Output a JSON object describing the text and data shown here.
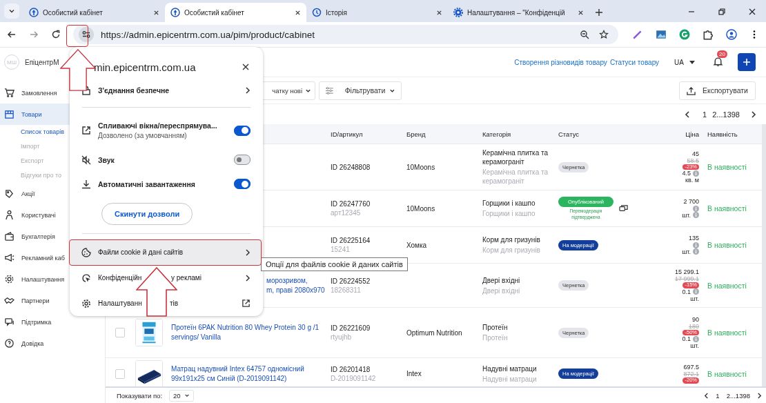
{
  "browser": {
    "tabs": [
      {
        "title": "Особистий кабінет",
        "kind": "site",
        "selected": false
      },
      {
        "title": "Особистий кабінет",
        "kind": "site",
        "selected": true
      },
      {
        "title": "Історія",
        "kind": "history",
        "selected": false
      },
      {
        "title": "Налаштування – \"Конфіденцій",
        "kind": "settings",
        "selected": false
      }
    ],
    "url": "https://admin.epicentrm.com.ua/pim/product/cabinet"
  },
  "app": {
    "avatar": "МШ",
    "brand": "ЕпіцентрМ",
    "header_links": [
      "Створення різновидів товару",
      "Статуси товару"
    ],
    "language": "UA",
    "notifications": "20"
  },
  "sidebar": {
    "items": [
      {
        "label": "Замовлення",
        "selected": false
      },
      {
        "label": "Товари",
        "selected": true,
        "children": [
          {
            "label": "Список товарів",
            "selected": true
          },
          {
            "label": "Імпорт",
            "selected": false
          },
          {
            "label": "Експорт",
            "selected": false
          },
          {
            "label": "Відгуки про то",
            "selected": false
          }
        ]
      },
      {
        "label": "Акції",
        "selected": false
      },
      {
        "label": "Користувачі",
        "selected": false
      },
      {
        "label": "Бухгалтерія",
        "selected": false
      },
      {
        "label": "Рекламний каб",
        "selected": false
      },
      {
        "label": "Налаштування",
        "selected": false
      },
      {
        "label": "Партнери",
        "selected": false
      },
      {
        "label": "Підтримка",
        "selected": false
      },
      {
        "label": "Довідка",
        "selected": false
      }
    ]
  },
  "toolbar": {
    "sort": "чатку нові",
    "filter": "Фільтрувати",
    "export": "Експортувати"
  },
  "pagination": {
    "current": "1",
    "rest": "2...1398"
  },
  "table": {
    "columns": [
      "ID/артикул",
      "Бренд",
      "Категорія",
      "Статус",
      "Ціна",
      "Наявність"
    ],
    "rows": [
      {
        "id": "ID 26248808",
        "brand": "10Moons",
        "category": "Керамічна плитка та керамограніт",
        "category_sub": "Керамічна плитка та керамограніт",
        "status": {
          "kind": "draft",
          "label": "Чернетка"
        },
        "price": "45",
        "old_price": "58.5",
        "discount": "-23%",
        "qty": "4.5",
        "unit": "кв. м",
        "availability": "В наявності"
      },
      {
        "id": "ID 26247760",
        "article": "арт12345",
        "brand": "10Moons",
        "category": "Горщики і кашпо",
        "category_sub": "Горщики і кашпо",
        "status": {
          "kind": "published",
          "label": "Опублікований",
          "note": "Перемодерація підтверджена"
        },
        "comments": true,
        "price": "2 700",
        "unit": "шт.",
        "availability": "В наявності"
      },
      {
        "id": "ID 26225164",
        "article": "15241",
        "brand": "Хомка",
        "category": "Корм для гризунів",
        "category_sub": "Корм для гризунів",
        "status": {
          "kind": "moderation",
          "label": "На модерації"
        },
        "price": "135",
        "unit": "шт.",
        "availability": "В наявності"
      },
      {
        "name_lines": [
          "морозривом,",
          "m, праві 2080x970"
        ],
        "id": "ID 26224552",
        "article": "18268311",
        "category": "Двері вхідні",
        "category_sub": "Двері вхідні",
        "status": {
          "kind": "draft",
          "label": "Чернетка"
        },
        "price": "15 299.1",
        "old_price": "17 999.1",
        "discount": "-15%",
        "qty": "0.1",
        "unit": "шт.",
        "availability": "В наявності"
      },
      {
        "checked": false,
        "name": "Протеїн 6PAK Nutrition 80 Whey Protein 30 g /1 servings/ Vanilla",
        "id": "ID 26221609",
        "article": "rtyujhb",
        "brand": "Optimum Nutrition",
        "category": "Протеїн",
        "category_sub": "Протеїн",
        "status": {
          "kind": "draft",
          "label": "Чернетка"
        },
        "price": "90",
        "old_price": "180",
        "discount": "-50%",
        "qty": "0.1",
        "unit": "шт.",
        "availability": "В наявності"
      },
      {
        "checked": false,
        "name": "Матрац надувний Intex 64757 одномісний 99x191x25 см Синій (D-2019091142)",
        "id": "ID 26201418",
        "article": "D-2019091142",
        "brand": "Intex",
        "category": "Надувні матраци",
        "category_sub": "Надувні матраци",
        "status": {
          "kind": "moderation",
          "label": "На модерації"
        },
        "price": "697.5",
        "old_price": "872.1",
        "discount": "-20%",
        "availability": "В наявності"
      }
    ]
  },
  "footer": {
    "page_size_label": "Показувати по:",
    "page_size": "20",
    "current": "1",
    "rest": "2...1398"
  },
  "popup": {
    "site": "min.epicentrm.com.ua",
    "secure": "З'єднання безпечне",
    "permissions": [
      {
        "label": "Спливаючі вікна/переспрямува...",
        "sub": "Дозволено (за умовчанням)",
        "on": true
      },
      {
        "label": "Звук",
        "on": false
      },
      {
        "label": "Автоматичні завантаження",
        "on": true
      }
    ],
    "reset": "Скинути дозволи",
    "links": [
      {
        "kind": "submenu",
        "parts": [
          "Файли cookie й дані сайтів"
        ],
        "selected": true
      },
      {
        "kind": "submenu",
        "parts": [
          "Конфіденційн",
          "у рекламі"
        ],
        "selected": false
      },
      {
        "kind": "external",
        "parts": [
          "Налаштуванн",
          "тів"
        ],
        "selected": false
      }
    ]
  },
  "tooltip": "Опції для файлів cookie й даних сайтів",
  "annotations": [
    {
      "kind": "frame"
    },
    {
      "kind": "arrow"
    },
    {
      "kind": "frame"
    },
    {
      "kind": "arrow"
    }
  ]
}
